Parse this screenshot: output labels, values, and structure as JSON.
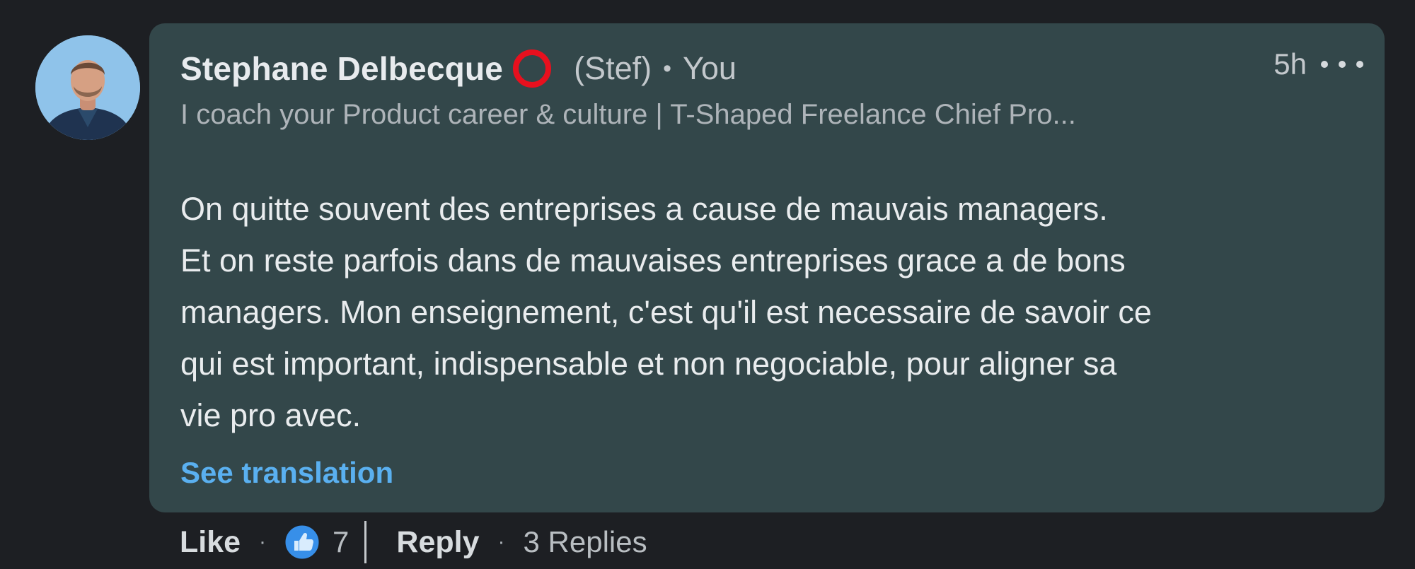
{
  "comment": {
    "author": {
      "name": "Stephane Delbecque",
      "nickname": "(Stef)",
      "relation": "You",
      "headline": "I coach your Product career & culture | T-Shaped Freelance Chief Pro..."
    },
    "timestamp": "5h",
    "body_lines": [
      "On quitte souvent des entreprises a cause de mauvais managers.",
      "Et on reste parfois dans de mauvaises entreprises grace a de bons",
      "managers. Mon enseignement, c'est qu'il est necessaire de savoir ce",
      "qui est important, indispensable et non negociable, pour aligner sa",
      "vie pro avec."
    ],
    "see_translation": "See translation"
  },
  "actions": {
    "like_label": "Like",
    "like_count": "7",
    "reply_label": "Reply",
    "replies_label": "3 Replies"
  },
  "icons": {
    "avatar": "profile-photo",
    "badge": "open-to-work-ring-icon",
    "more": "more-horizontal-icon",
    "reaction": "thumbs-up-icon"
  },
  "colors": {
    "background": "#1d1f23",
    "bubble": "#33474a",
    "link": "#5ab0f0",
    "ring": "#e8101e",
    "like_icon": "#378fe9"
  }
}
